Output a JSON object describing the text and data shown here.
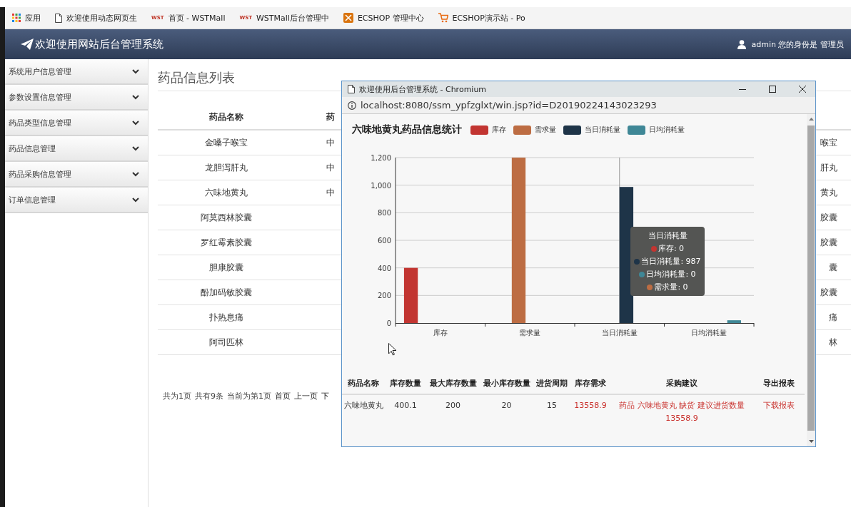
{
  "bookmarks": [
    {
      "label": "应用"
    },
    {
      "label": "欢迎使用动态网页生"
    },
    {
      "badge": "WST",
      "label": "首页 - WSTMall"
    },
    {
      "badge": "WST",
      "label": "WSTMall后台管理中"
    },
    {
      "label": "ECSHOP 管理中心"
    },
    {
      "label": "ECSHOP演示站 - Po"
    }
  ],
  "header": {
    "title": "欢迎使用网站后台管理系统",
    "user": "admin 您的身份是 管理员"
  },
  "sidebar": {
    "items": [
      {
        "label": "系统用户信息管理"
      },
      {
        "label": "参数设置信息管理"
      },
      {
        "label": "药品类型信息管理"
      },
      {
        "label": "药品信息管理"
      },
      {
        "label": "药品采购信息管理"
      },
      {
        "label": "订单信息管理"
      }
    ]
  },
  "main": {
    "title": "药品信息列表",
    "table": {
      "columns": [
        "药品名称",
        "药"
      ],
      "rows": [
        {
          "cells": [
            "金嗓子喉宝",
            "中"
          ],
          "column_last": "喉宝"
        },
        {
          "cells": [
            "龙胆泻肝丸",
            "中"
          ],
          "column_last": "肝丸"
        },
        {
          "cells": [
            "六味地黄丸",
            "中"
          ],
          "column_last": "黄丸"
        },
        {
          "cells": [
            "阿莫西林胶囊"
          ],
          "column_last": "胶囊"
        },
        {
          "cells": [
            "罗红霉素胶囊"
          ],
          "column_last": "胶囊"
        },
        {
          "cells": [
            "胆康胶囊"
          ],
          "column_last": "囊"
        },
        {
          "cells": [
            "酚加码敏胶囊"
          ],
          "column_last": "胶囊"
        },
        {
          "cells": [
            "扑热息痛"
          ],
          "column_last": "痛"
        },
        {
          "cells": [
            "阿司匹林"
          ],
          "column_last": "林"
        }
      ]
    },
    "pagination": [
      {
        "kind": "text",
        "label": "共为1页"
      },
      {
        "kind": "text",
        "label": "共有9条"
      },
      {
        "kind": "text",
        "label": "当前为第1页"
      },
      {
        "kind": "link",
        "label": "首页"
      },
      {
        "kind": "link",
        "label": "上一页"
      },
      {
        "kind": "link",
        "label": "下"
      }
    ]
  },
  "popup": {
    "title": "欢迎使用后台管理系统 - Chromium",
    "url": "localhost:8080/ssm_ypfzglxt/win.jsp?id=D20190224143023293",
    "chart_title": "六味地黄丸药品信息统计",
    "chart_data": {
      "type": "bar",
      "grid": true,
      "ref_lines": [
        {
          "axis": "x",
          "value": "当日消耗量"
        }
      ],
      "categories": [
        "库存",
        "需求量",
        "当日消耗量",
        "日均消耗量"
      ],
      "series": [
        {
          "name": "库存",
          "color": "#c23531",
          "values": [
            400,
            0,
            0,
            0
          ]
        },
        {
          "name": "需求量",
          "color": "#bd6d43",
          "values": [
            0,
            1200,
            0,
            0
          ]
        },
        {
          "name": "当日消耗量",
          "color": "#1e3448",
          "values": [
            0,
            0,
            987,
            0
          ]
        },
        {
          "name": "日均消耗量",
          "color": "#3f8796",
          "values": [
            0,
            0,
            0,
            20
          ]
        }
      ],
      "ylim": [
        0,
        1200
      ],
      "yticks": [
        {
          "value": 0,
          "label": "0"
        },
        {
          "value": 200,
          "label": "200"
        },
        {
          "value": 400,
          "label": "400"
        },
        {
          "value": 600,
          "label": "600"
        },
        {
          "value": 800,
          "label": "800"
        },
        {
          "value": 1000,
          "label": "1,000"
        },
        {
          "value": 1200,
          "label": "1,200"
        }
      ]
    },
    "tooltip": {
      "title": "当日消耗量",
      "items": [
        {
          "text": "库存: 0",
          "color": "#c23531"
        },
        {
          "text": "当日消耗量: 987",
          "color": "#1e3448"
        },
        {
          "text": "日均消耗量: 0",
          "color": "#3f8796"
        },
        {
          "text": "需求量: 0",
          "color": "#bd6d43"
        }
      ]
    },
    "table": {
      "columns": [
        "药品名称",
        "库存数量",
        "最大库存数量",
        "最小库存数量",
        "进货周期",
        "库存需求",
        "采购建议",
        "导出报表"
      ],
      "rows": [
        {
          "cells": [
            {
              "kind": "plain",
              "text": "六味地黄丸"
            },
            {
              "kind": "plain",
              "text": "400.1"
            },
            {
              "kind": "plain",
              "text": "200"
            },
            {
              "kind": "plain",
              "text": "20"
            },
            {
              "kind": "plain",
              "text": "15"
            },
            {
              "kind": "alert",
              "text": "13558.9"
            },
            {
              "kind": "alert",
              "text": "药品 六味地黄丸 缺货 建议进货数量 13558.9"
            },
            {
              "kind": "link",
              "text": "下载报表"
            }
          ]
        }
      ]
    }
  }
}
